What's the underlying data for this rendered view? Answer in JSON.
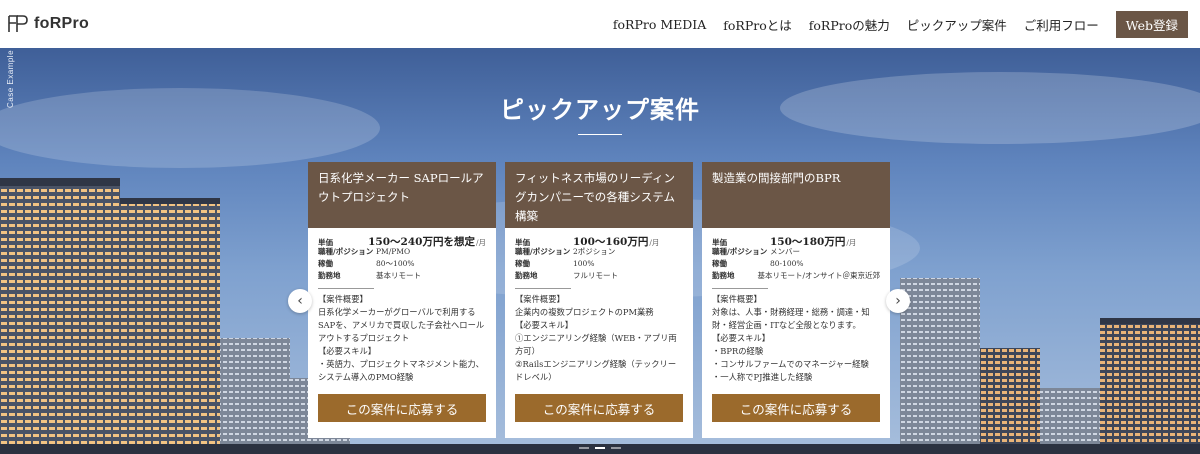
{
  "header": {
    "logo_text": "foRPro",
    "nav": [
      "foRPro MEDIA",
      "foRProとは",
      "foRProの魅力",
      "ピックアップ案件",
      "ご利用フロー"
    ],
    "cta": "Web登録"
  },
  "hero": {
    "side_label": "Case Example",
    "title": "ピックアップ案件"
  },
  "cards": [
    {
      "title": "日系化学メーカー SAPロールアウトプロジェクト",
      "labels": {
        "price": "単価",
        "role": "職種/ポジション",
        "rate": "稼働",
        "location": "勤務地"
      },
      "price": "150〜240万円を想定",
      "unit": "/月",
      "role": "PM/PMO",
      "rate": "80〜100%",
      "location": "基本リモート",
      "description": "【案件概要】\n日系化学メーカーがグローバルで利用するSAPを、アメリカで買収した子会社へロールアウトするプロジェクト\n【必要スキル】\n・英語力、プロジェクトマネジメント能力、システム導入のPMO経験",
      "button": "この案件に応募する"
    },
    {
      "title": "フィットネス市場のリーディングカンパニーでの各種システム構築",
      "labels": {
        "price": "単価",
        "role": "職種/ポジション",
        "rate": "稼働",
        "location": "勤務地"
      },
      "price": "100〜160万円",
      "unit": "/月",
      "role": "2ポジション",
      "rate": "100%",
      "location": "フルリモート",
      "description": "【案件概要】\n企業内の複数プロジェクトのPM業務\n【必要スキル】\n①エンジニアリング経験（WEB・アプリ両方可）\n②Railsエンジニアリング経験（テックリードレベル）",
      "button": "この案件に応募する"
    },
    {
      "title": "製造業の間接部門のBPR",
      "labels": {
        "price": "単価",
        "role": "職種/ポジション",
        "rate": "稼働",
        "location": "勤務地"
      },
      "price": "150〜180万円",
      "unit": "/月",
      "role": "メンバー",
      "rate": "80-100%",
      "location": "基本リモート/オンサイト＠東京近郊",
      "description": "【案件概要】\n対象は、人事・財務経理・総務・調達・知財・経営企画・ITなど全般となります。\n【必要スキル】\n・BPRの経験\n・コンサルファームでのマネージャー経験\n・一人称でPJ推進した経験",
      "button": "この案件に応募する"
    }
  ],
  "carousel": {
    "prev_icon": "chevron-left-icon",
    "next_icon": "chevron-right-icon",
    "prev": "‹",
    "next": "›",
    "dot_count": 3,
    "active_dot": 1
  },
  "colors": {
    "brand_brown": "#6b5646",
    "button_brown": "#9b6a2c",
    "sky": "#5f84bd"
  }
}
